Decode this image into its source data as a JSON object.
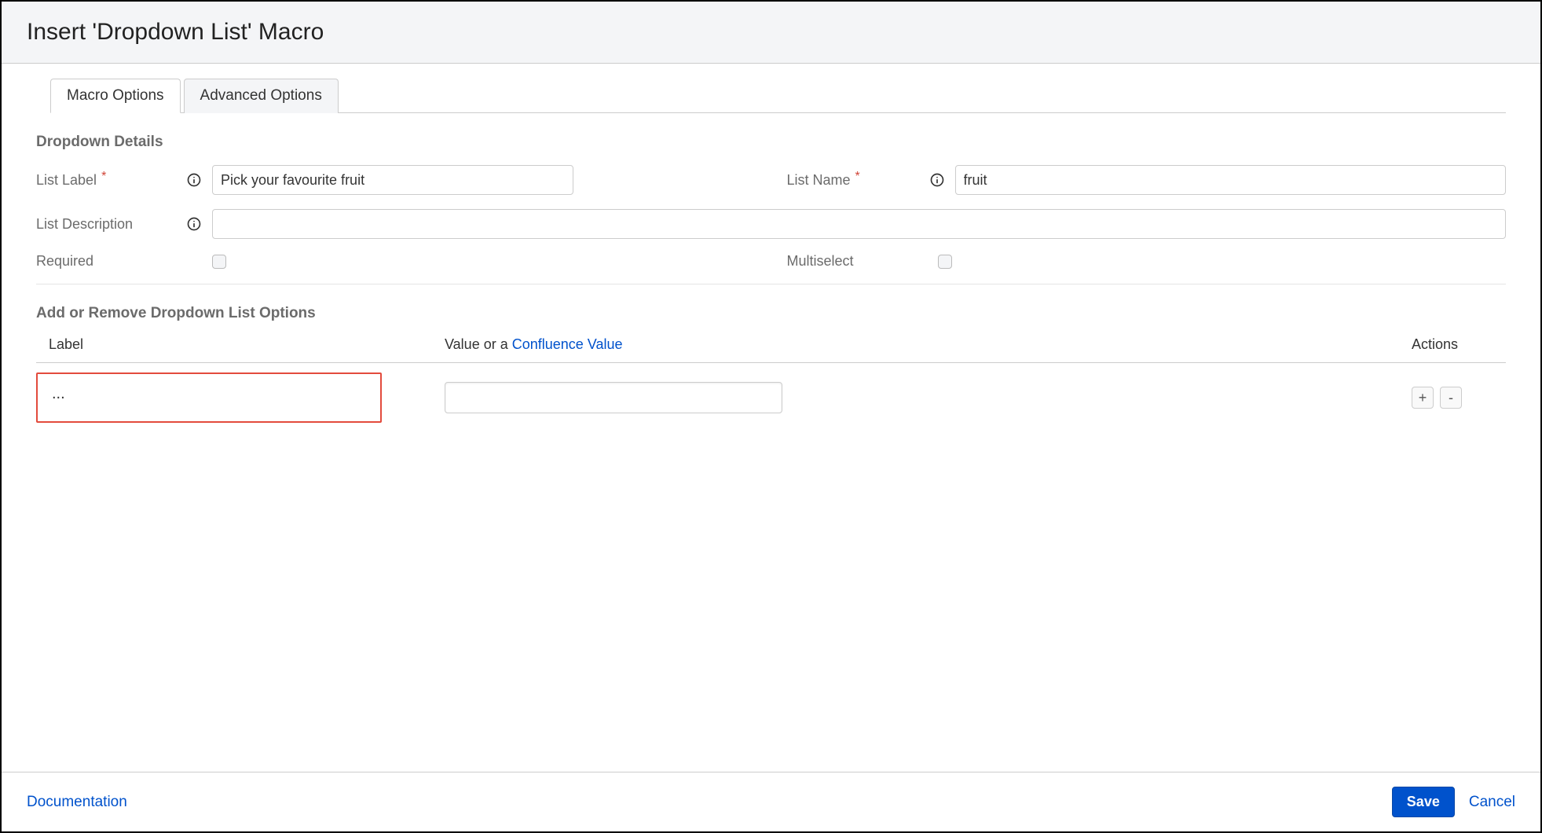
{
  "dialog": {
    "title": "Insert 'Dropdown List' Macro"
  },
  "tabs": {
    "macro_options": "Macro Options",
    "advanced_options": "Advanced Options"
  },
  "sections": {
    "details_title": "Dropdown Details",
    "options_title": "Add or Remove Dropdown List Options"
  },
  "fields": {
    "list_label": {
      "label": "List Label",
      "value": "Pick your favourite fruit"
    },
    "list_name": {
      "label": "List Name",
      "value": "fruit"
    },
    "list_description": {
      "label": "List Description",
      "value": ""
    },
    "required": {
      "label": "Required",
      "checked": false
    },
    "multiselect": {
      "label": "Multiselect",
      "checked": false
    }
  },
  "options_table": {
    "head_label": "Label",
    "head_value_prefix": "Value or a ",
    "head_value_link": "Confluence Value",
    "head_actions": "Actions",
    "rows": [
      {
        "label": "...",
        "value": ""
      }
    ],
    "add_symbol": "+",
    "remove_symbol": "-"
  },
  "footer": {
    "documentation": "Documentation",
    "save": "Save",
    "cancel": "Cancel"
  }
}
